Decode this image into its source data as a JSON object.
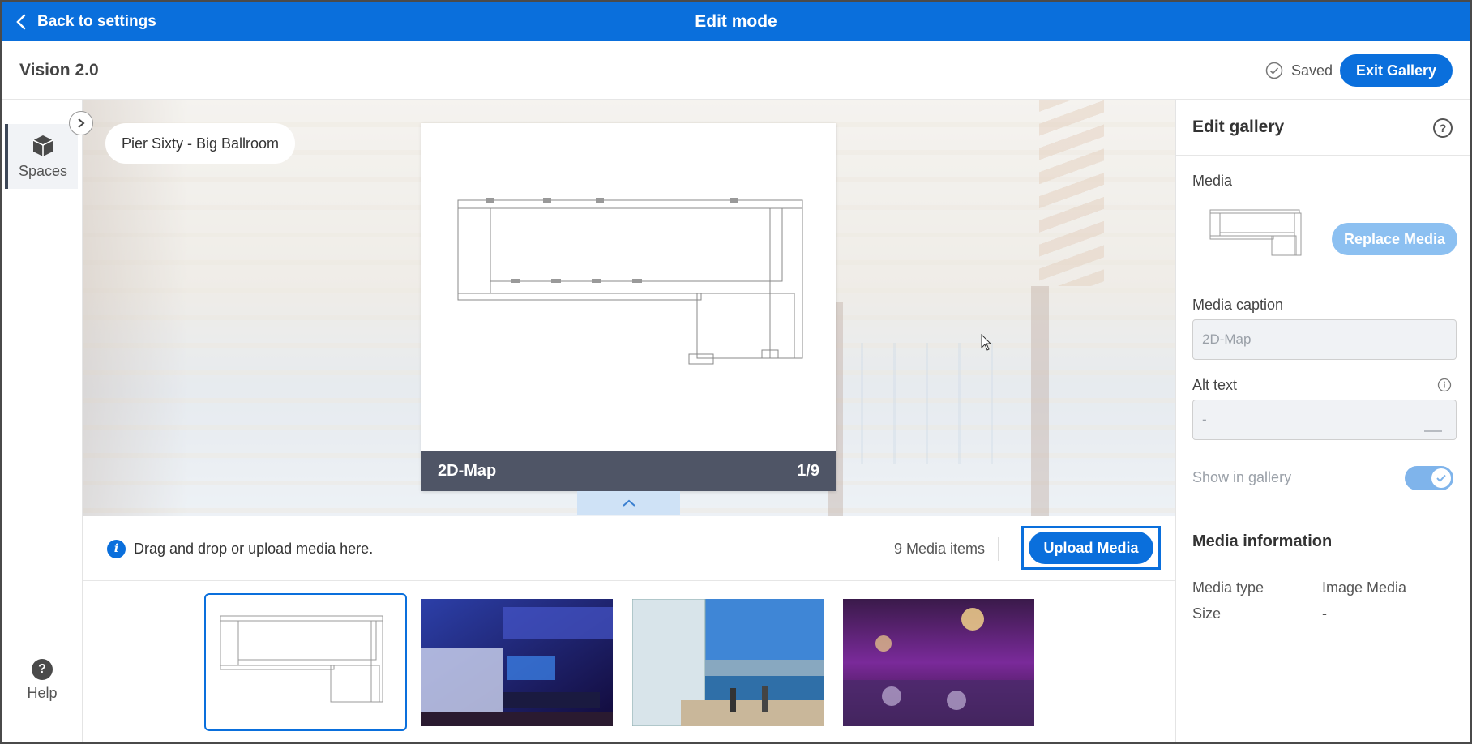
{
  "topbar": {
    "back_label": "Back to settings",
    "title": "Edit mode"
  },
  "header": {
    "app_name": "Vision 2.0",
    "saved_label": "Saved",
    "exit_label": "Exit Gallery"
  },
  "rail": {
    "spaces_label": "Spaces",
    "help_label": "Help",
    "help_glyph": "?"
  },
  "preview": {
    "space_name": "Pier Sixty - Big Ballroom",
    "current_caption": "2D-Map",
    "position": "1/9"
  },
  "upload_bar": {
    "hint": "Drag and drop or upload media here.",
    "info_glyph": "i",
    "count_label": "9 Media items",
    "upload_label": "Upload Media"
  },
  "thumbnails": [
    {
      "name": "2D-Map",
      "kind": "floorplan",
      "selected": true
    },
    {
      "name": "thumb-2",
      "kind": "stage-blue",
      "selected": false
    },
    {
      "name": "thumb-3",
      "kind": "terrace",
      "selected": false
    },
    {
      "name": "thumb-4",
      "kind": "ballroom-purple",
      "selected": false
    }
  ],
  "panel": {
    "title": "Edit gallery",
    "help_glyph": "?",
    "media_label": "Media",
    "replace_label": "Replace Media",
    "caption_label": "Media caption",
    "caption_placeholder": "2D-Map",
    "alt_label": "Alt text",
    "alt_placeholder": "-",
    "show_label": "Show in gallery",
    "show_in_gallery": true,
    "info_title": "Media information",
    "info": [
      {
        "key": "Media type",
        "value": "Image Media"
      },
      {
        "key": "Size",
        "value": "-"
      }
    ]
  },
  "colors": {
    "primary": "#0a6fdc",
    "caption_bar": "#4f5566",
    "disabled_button": "#8cc0f1"
  }
}
